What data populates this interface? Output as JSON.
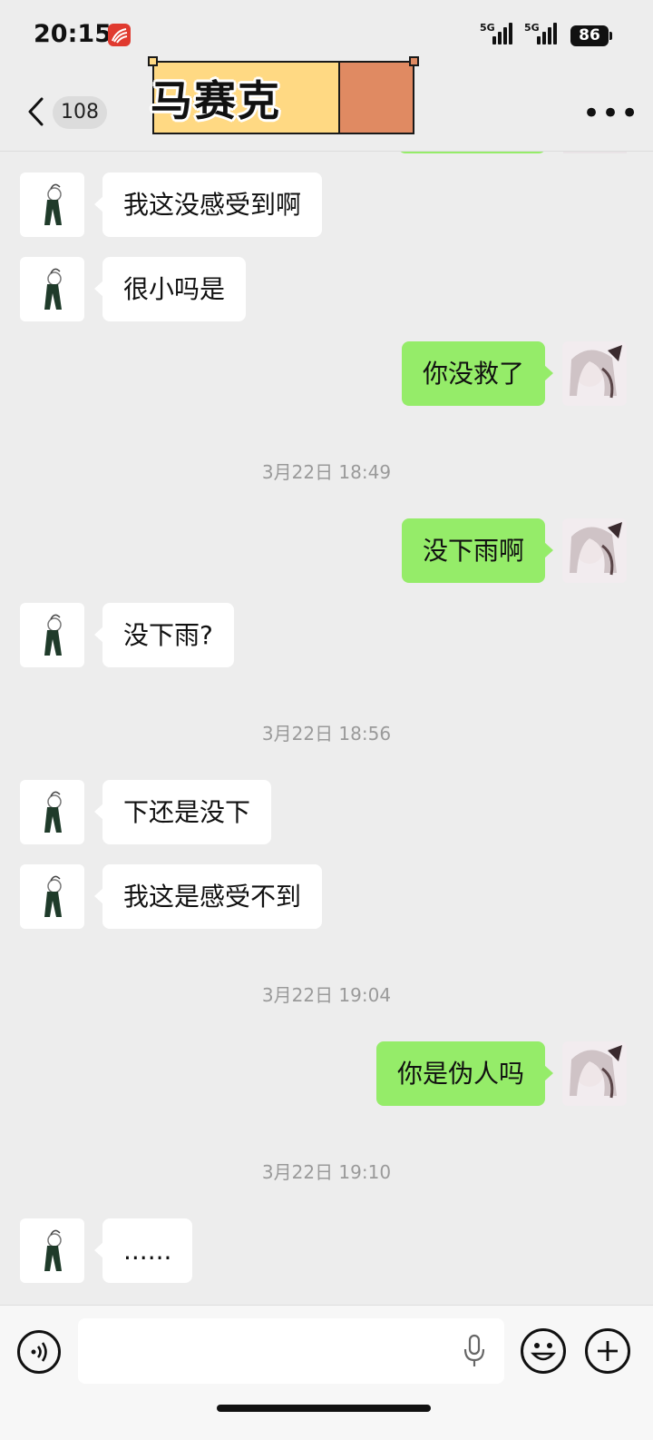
{
  "status_bar": {
    "time": "20:15",
    "network_label_1": "5G",
    "network_label_2": "5G",
    "battery": "86",
    "app_icon": "red-app-icon"
  },
  "header": {
    "unread_count": "108",
    "title": "马赛克",
    "back_icon": "chevron-left-icon",
    "more_icon": "more-dots-icon"
  },
  "messages": [
    {
      "side": "in",
      "text": "我这没感受到啊"
    },
    {
      "side": "in",
      "text": "很小吗是"
    },
    {
      "side": "out",
      "text": "你没救了"
    },
    {
      "side": "time",
      "text": "3月22日 18:49"
    },
    {
      "side": "out",
      "text": "没下雨啊"
    },
    {
      "side": "in",
      "text": "没下雨?"
    },
    {
      "side": "time",
      "text": "3月22日 18:56"
    },
    {
      "side": "in",
      "text": "下还是没下"
    },
    {
      "side": "in",
      "text": "我这是感受不到"
    },
    {
      "side": "time",
      "text": "3月22日 19:04"
    },
    {
      "side": "out",
      "text": "你是伪人吗"
    },
    {
      "side": "time",
      "text": "3月22日 19:10"
    },
    {
      "side": "in",
      "text": "......"
    }
  ],
  "input_bar": {
    "value": "",
    "voice_icon": "voice-icon",
    "mic_icon": "microphone-icon",
    "emoji_icon": "emoji-icon",
    "plus_icon": "plus-icon"
  },
  "colors": {
    "background": "#ededed",
    "outgoing_bubble": "#95ec69",
    "incoming_bubble": "#ffffff",
    "title_yellow": "#ffd983",
    "title_orange": "#e08a62"
  }
}
